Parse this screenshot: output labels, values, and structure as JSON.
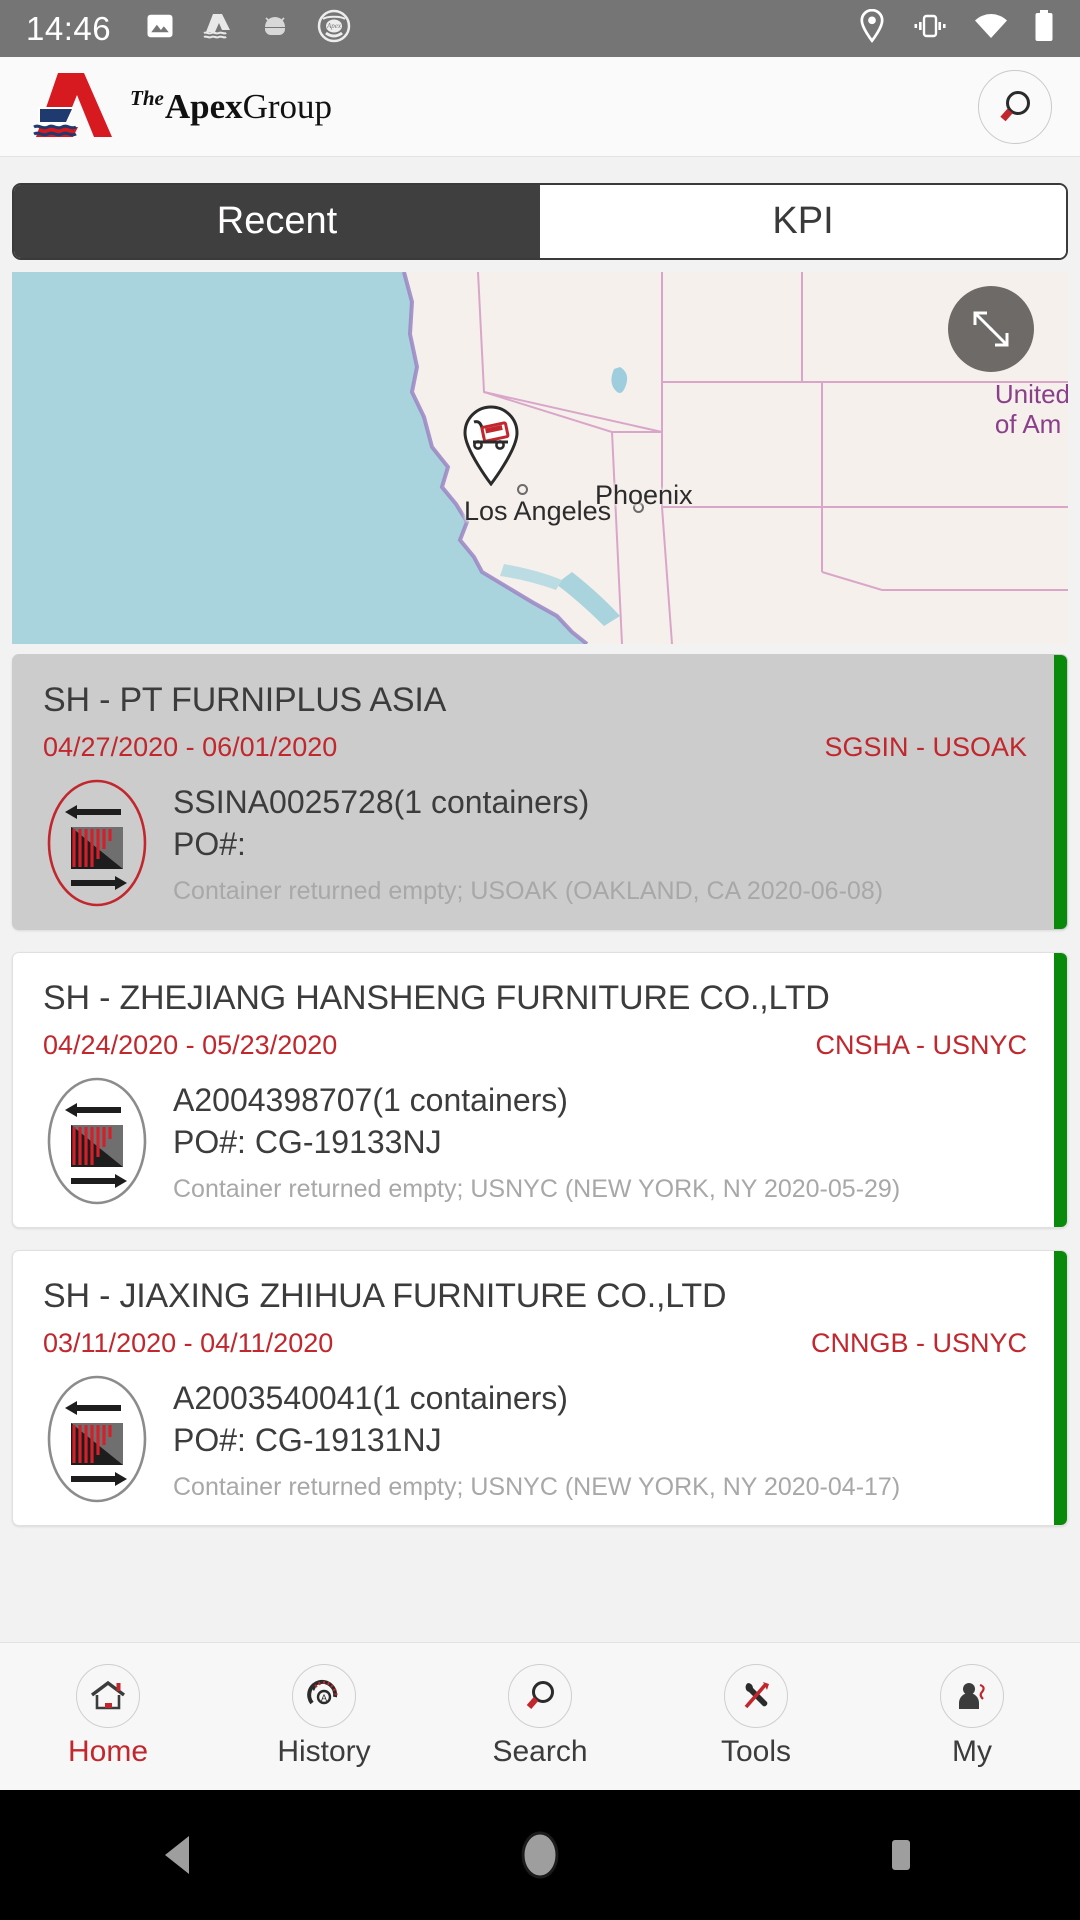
{
  "statusbar": {
    "time": "14:46",
    "left_icons": [
      "image-icon",
      "apex-ship-icon",
      "android-icon",
      "apex-badge-icon"
    ],
    "right_icons": [
      "location-icon",
      "vibrate-icon",
      "wifi-icon",
      "battery-icon"
    ]
  },
  "header": {
    "logo_the": "The",
    "logo_apex": "Apex",
    "logo_group": "Group",
    "search_icon": "search-icon"
  },
  "tabs": [
    {
      "label": "Recent",
      "active": true
    },
    {
      "label": "KPI",
      "active": false
    }
  ],
  "map": {
    "country_line1": "United",
    "country_line2": "of Am",
    "cities": [
      {
        "name": "Los Angeles"
      },
      {
        "name": "Phoenix"
      }
    ],
    "expand_icon": "expand-arrows-icon",
    "marker_icon": "container-truck-marker-icon",
    "colors": {
      "water": "#a9d3dd",
      "land": "#f5f0ec",
      "border": "#d9a6c9",
      "label": "#8a3f8a"
    }
  },
  "shipments": [
    {
      "title": "SH - PT FURNIPLUS ASIA",
      "dates": "04/27/2020 - 06/01/2020",
      "route": "SGSIN - USOAK",
      "bl": "SSINA0025728(1 containers)",
      "po": "PO#:",
      "status": "Container returned empty; USOAK (OAKLAND, CA  2020-06-08)",
      "selected": true,
      "stripe_color": "#0a8a0a",
      "icon": "container-transfer-icon"
    },
    {
      "title": "SH - ZHEJIANG HANSHENG FURNITURE CO.,LTD",
      "dates": "04/24/2020 - 05/23/2020",
      "route": "CNSHA - USNYC",
      "bl": "A2004398707(1 containers)",
      "po": "PO#: CG-19133NJ",
      "status": "Container returned empty; USNYC (NEW YORK, NY  2020-05-29)",
      "selected": false,
      "stripe_color": "#0a8a0a",
      "icon": "container-transfer-icon"
    },
    {
      "title": "SH - JIAXING ZHIHUA FURNITURE CO.,LTD",
      "dates": "03/11/2020 - 04/11/2020",
      "route": "CNNGB - USNYC",
      "bl": "A2003540041(1 containers)",
      "po": "PO#: CG-19131NJ",
      "status": "Container returned empty; USNYC (NEW YORK, NY  2020-04-17)",
      "selected": false,
      "stripe_color": "#0a8a0a",
      "icon": "container-transfer-icon"
    }
  ],
  "bottom_nav": [
    {
      "label": "Home",
      "icon": "home-icon",
      "active": true
    },
    {
      "label": "History",
      "icon": "history-gauge-icon",
      "active": false
    },
    {
      "label": "Search",
      "icon": "search-icon",
      "active": false
    },
    {
      "label": "Tools",
      "icon": "tools-icon",
      "active": false
    },
    {
      "label": "My",
      "icon": "user-icon",
      "active": false
    }
  ],
  "system_nav": {
    "back": "back-triangle-icon",
    "home": "home-circle-icon",
    "recents": "recents-square-icon"
  },
  "colors": {
    "accent_red": "#c1272d",
    "status_green": "#0a8a0a",
    "tab_dark": "#403f3f",
    "statusbar_gray": "#757575"
  }
}
